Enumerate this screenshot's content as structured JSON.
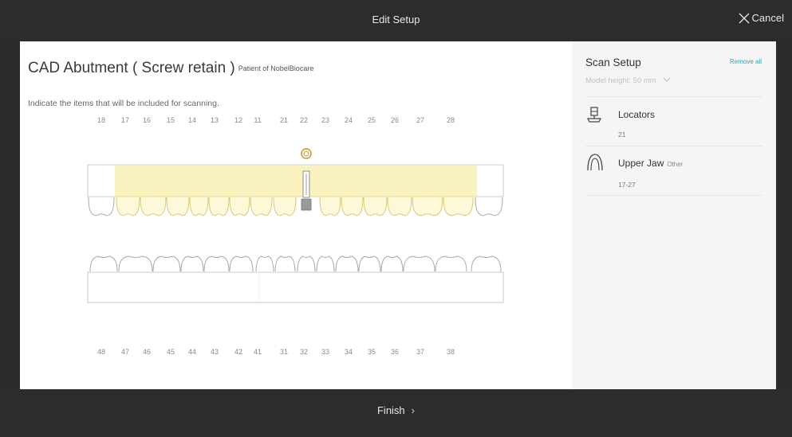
{
  "header": {
    "title": "Edit Setup",
    "cancel_label": "Cancel"
  },
  "footer": {
    "finish_label": "Finish"
  },
  "main": {
    "title": "CAD Abutment ( Screw retain )",
    "subtitle": "Patient of NobelBiocare",
    "instruction": "Indicate the items that will be included for scanning.",
    "upper_teeth": [
      "18",
      "17",
      "16",
      "15",
      "14",
      "13",
      "12",
      "11",
      "21",
      "22",
      "23",
      "24",
      "25",
      "26",
      "27",
      "28"
    ],
    "lower_teeth": [
      "48",
      "47",
      "46",
      "45",
      "44",
      "43",
      "42",
      "41",
      "31",
      "32",
      "33",
      "34",
      "35",
      "36",
      "37",
      "38"
    ]
  },
  "scan_setup": {
    "title": "Scan Setup",
    "remove_all": "Remove all",
    "model_height": "Model height: 50 mm",
    "items": [
      {
        "label": "Locators",
        "tag": "",
        "sub": "21",
        "icon": "locator-icon"
      },
      {
        "label": "Upper Jaw",
        "tag": "Other",
        "sub": "17-27",
        "icon": "upper-jaw-icon"
      }
    ]
  },
  "colors": {
    "highlight": "#fbf3bf",
    "accent": "#2aa7b5",
    "bar": "#2c2c2c"
  }
}
